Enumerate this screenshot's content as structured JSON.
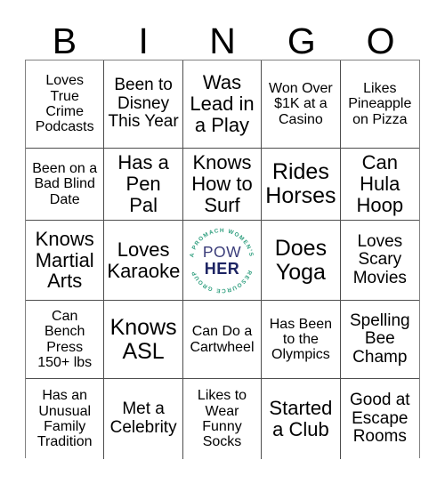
{
  "header": {
    "letters": [
      "B",
      "I",
      "N",
      "G",
      "O"
    ]
  },
  "logo": {
    "word_top": "POW",
    "word_bottom": "HER",
    "ring_text": "A PROMACH WOMEN'S RESOURCE GROUP",
    "ring_text_upper": "A PROMACH WOMEN'S",
    "ring_text_lower": "RESOURCE GROUP",
    "ring_color": "#2e9e7e",
    "word_top_color": "#3b3d7a",
    "word_bottom_color": "#1d2463"
  },
  "grid": {
    "rows": 5,
    "cols": 5,
    "cells": [
      {
        "text": "Loves\nTrue\nCrime\nPodcasts",
        "size": "fs-sm",
        "type": "square"
      },
      {
        "text": "Been to\nDisney\nThis Year",
        "size": "fs-md",
        "type": "square"
      },
      {
        "text": "Was\nLead in\na Play",
        "size": "fs-lg",
        "type": "square"
      },
      {
        "text": "Won Over\n$1K at a\nCasino",
        "size": "fs-sm",
        "type": "square"
      },
      {
        "text": "Likes\nPineapple\non Pizza",
        "size": "fs-sm",
        "type": "square"
      },
      {
        "text": "Been on a\nBad Blind\nDate",
        "size": "fs-sm",
        "type": "square"
      },
      {
        "text": "Has a\nPen\nPal",
        "size": "fs-lg",
        "type": "square"
      },
      {
        "text": "Knows\nHow to\nSurf",
        "size": "fs-lg",
        "type": "square"
      },
      {
        "text": "Rides\nHorses",
        "size": "fs-xl",
        "type": "square"
      },
      {
        "text": "Can\nHula\nHoop",
        "size": "fs-lg",
        "type": "square"
      },
      {
        "text": "Knows\nMartial\nArts",
        "size": "fs-lg",
        "type": "square"
      },
      {
        "text": "Loves\nKaraoke",
        "size": "fs-lg",
        "type": "square"
      },
      {
        "text": "",
        "size": "fs-md",
        "type": "logo"
      },
      {
        "text": "Does\nYoga",
        "size": "fs-xl",
        "type": "square"
      },
      {
        "text": "Loves\nScary\nMovies",
        "size": "fs-md",
        "type": "square"
      },
      {
        "text": "Can\nBench\nPress\n150+ lbs",
        "size": "fs-sm",
        "type": "square"
      },
      {
        "text": "Knows\nASL",
        "size": "fs-xl",
        "type": "square"
      },
      {
        "text": "Can Do a\nCartwheel",
        "size": "fs-sm",
        "type": "square"
      },
      {
        "text": "Has Been\nto the\nOlympics",
        "size": "fs-sm",
        "type": "square"
      },
      {
        "text": "Spelling\nBee\nChamp",
        "size": "fs-md",
        "type": "square"
      },
      {
        "text": "Has an\nUnusual\nFamily\nTradition",
        "size": "fs-sm",
        "type": "square"
      },
      {
        "text": "Met a\nCelebrity",
        "size": "fs-md",
        "type": "square"
      },
      {
        "text": "Likes to\nWear\nFunny\nSocks",
        "size": "fs-sm",
        "type": "square"
      },
      {
        "text": "Started\na Club",
        "size": "fs-lg",
        "type": "square"
      },
      {
        "text": "Good at\nEscape\nRooms",
        "size": "fs-md",
        "type": "square"
      }
    ]
  }
}
